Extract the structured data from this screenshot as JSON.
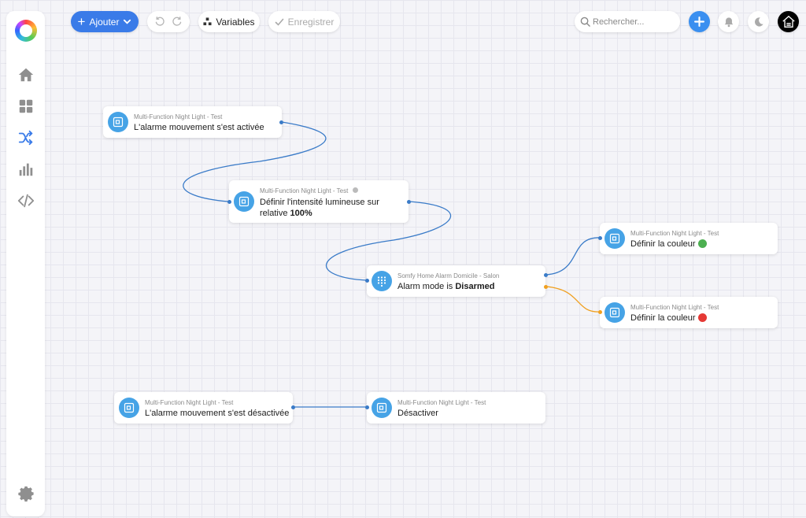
{
  "toolbar": {
    "add_label": "Ajouter",
    "variables_label": "Variables",
    "save_label": "Enregistrer",
    "search_placeholder": "Rechercher..."
  },
  "sidebar": {
    "items": [
      {
        "icon": "home-icon"
      },
      {
        "icon": "dashboard-grid-icon"
      },
      {
        "icon": "shuffle-icon",
        "active": true
      },
      {
        "icon": "bar-chart-icon"
      },
      {
        "icon": "code-icon"
      }
    ],
    "settings_icon": "gear-icon"
  },
  "colors": {
    "accent": "#3a7be8",
    "node_icon": "#46a3e6",
    "wire_blue": "#3a7bc8",
    "wire_orange": "#f0a020",
    "green": "#4caf50",
    "red": "#e53935"
  },
  "nodes": [
    {
      "id": "n1",
      "device": "Multi-Function Night Light - Test",
      "text": "L'alarme mouvement s'est activée"
    },
    {
      "id": "n2",
      "device": "Multi-Function Night Light - Test",
      "text_line1": "Définir l'intensité lumineuse sur",
      "text_line2_prefix": "relative ",
      "text_line2_bold": "100%"
    },
    {
      "id": "n3",
      "device": "Somfy Home Alarm Domicile - Salon",
      "text_prefix": "Alarm mode is ",
      "text_bold": "Disarmed"
    },
    {
      "id": "n4",
      "device": "Multi-Function Night Light - Test",
      "text": "Définir la couleur",
      "color": "green"
    },
    {
      "id": "n5",
      "device": "Multi-Function Night Light - Test",
      "text": "Définir la couleur",
      "color": "red"
    },
    {
      "id": "n6",
      "device": "Multi-Function Night Light - Test",
      "text": "L'alarme mouvement s'est désactivée"
    },
    {
      "id": "n7",
      "device": "Multi-Function Night Light - Test",
      "text": "Désactiver"
    }
  ]
}
